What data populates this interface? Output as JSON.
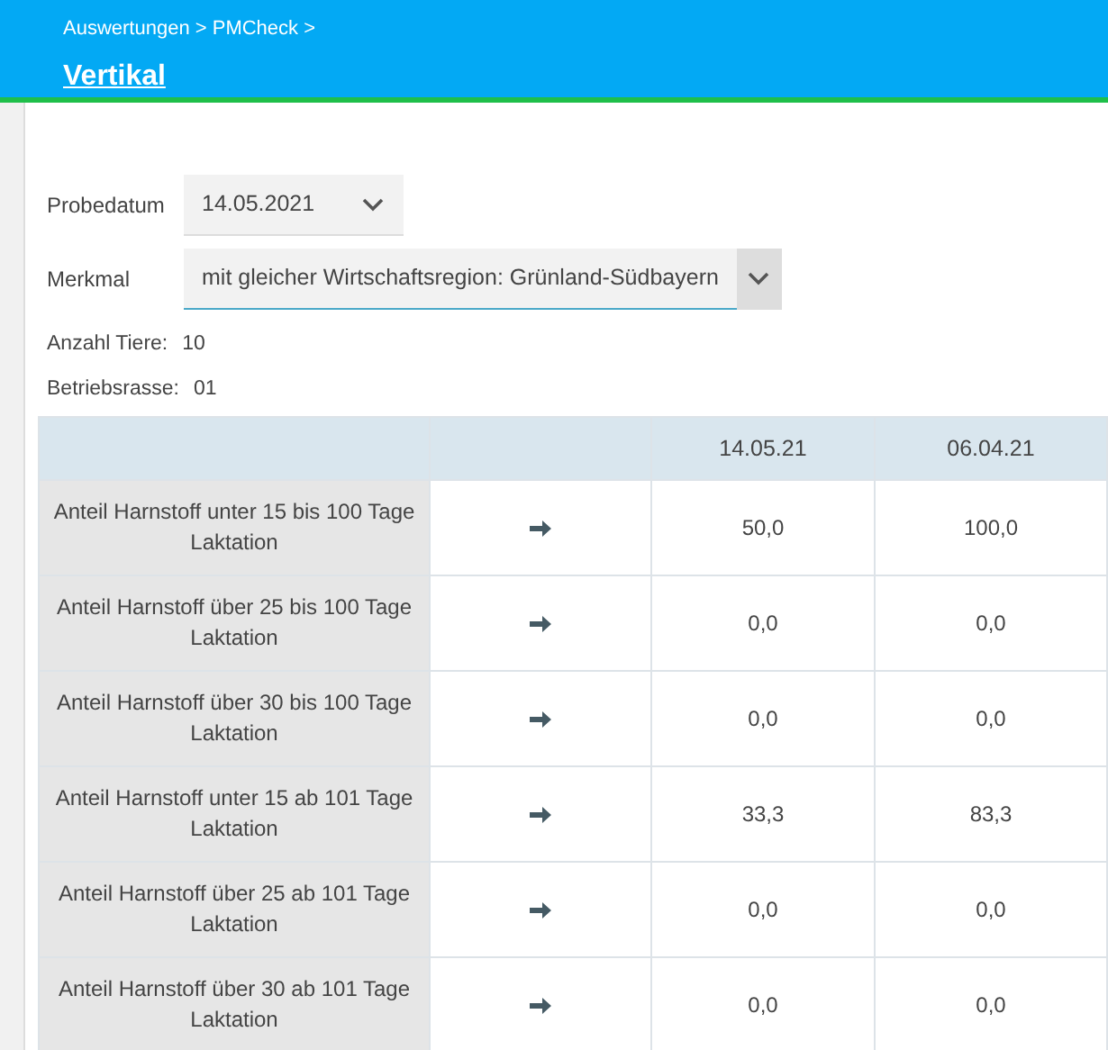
{
  "header": {
    "breadcrumb": "Auswertungen > PMCheck >",
    "title": "Vertikal"
  },
  "filters": [
    {
      "label": "Probedatum",
      "value": "14.05.2021",
      "focused": false
    },
    {
      "label": "Merkmal",
      "value": "mit gleicher Wirtschaftsregion: Grünland-Südbayern",
      "focused": true
    }
  ],
  "info": [
    {
      "label": "Anzahl Tiere:",
      "value": "10"
    },
    {
      "label": "Betriebsrasse:",
      "value": "01"
    }
  ],
  "table": {
    "columns": [
      "14.05.21",
      "06.04.21"
    ],
    "rows": [
      {
        "label": "Anteil Harnstoff unter 15 bis 100 Tage Laktation",
        "values": [
          "50,0",
          "100,0"
        ]
      },
      {
        "label": "Anteil Harnstoff über 25 bis 100 Tage Laktation",
        "values": [
          "0,0",
          "0,0"
        ]
      },
      {
        "label": "Anteil Harnstoff über 30 bis 100 Tage Laktation",
        "values": [
          "0,0",
          "0,0"
        ]
      },
      {
        "label": "Anteil Harnstoff unter 15 ab 101 Tage Laktation",
        "values": [
          "33,3",
          "83,3"
        ]
      },
      {
        "label": "Anteil Harnstoff über 25 ab 101 Tage Laktation",
        "values": [
          "0,0",
          "0,0"
        ]
      },
      {
        "label": "Anteil Harnstoff über 30 ab 101 Tage Laktation",
        "values": [
          "0,0",
          "0,0"
        ]
      }
    ]
  }
}
